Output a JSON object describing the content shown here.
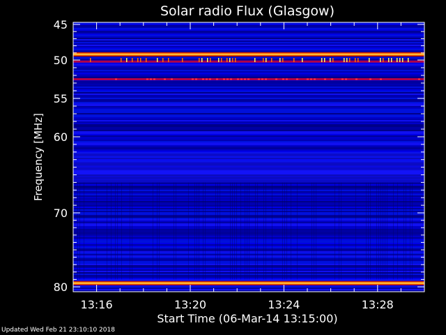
{
  "chart_data": {
    "type": "heatmap",
    "title": "Solar radio Flux (Glasgow)",
    "xlabel": "Start Time (06-Mar-14 13:15:00)",
    "ylabel": "Frequency [MHz]",
    "x_ticks": [
      {
        "label": "13:16",
        "min": 1
      },
      {
        "label": "13:20",
        "min": 5
      },
      {
        "label": "13:24",
        "min": 9
      },
      {
        "label": "13:28",
        "min": 13
      }
    ],
    "xlim_minutes": [
      0,
      15
    ],
    "y_ticks": [
      45,
      50,
      55,
      60,
      70,
      80
    ],
    "ylim": [
      44.5,
      80.5
    ],
    "y_scale": "nonlinear",
    "colormap": "blue-red-yellow-white",
    "strong_bands_mhz": [
      49.2,
      79.5
    ],
    "medium_bands_mhz": [
      50.2,
      52.5
    ],
    "background_color": "#0000c0"
  },
  "footer": {
    "updated": "Updated Wed Feb 21 23:10:10 2018"
  }
}
